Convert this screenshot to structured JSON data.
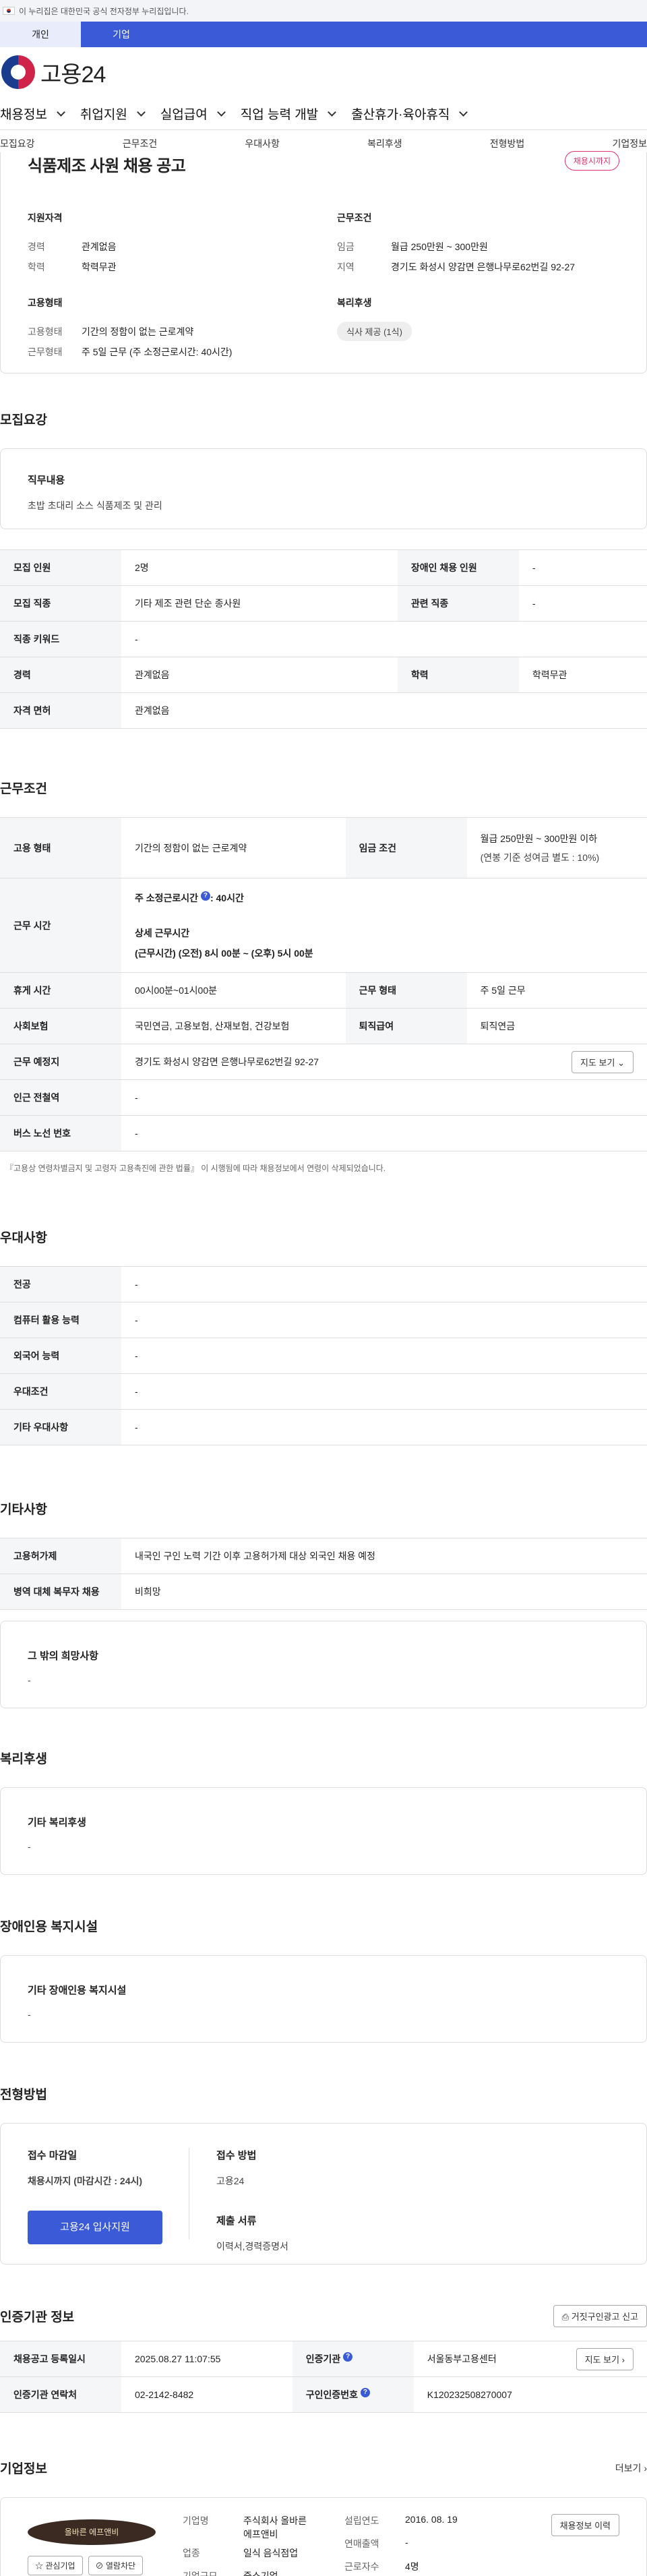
{
  "gov_banner": "이 누리집은 대한민국 공식 전자정부 누리집입니다.",
  "user_tabs": [
    "개인",
    "기업"
  ],
  "logo": "고용24",
  "gnb": [
    "채용정보",
    "취업지원",
    "실업급여",
    "직업 능력 개발",
    "출산휴가·육아휴직"
  ],
  "anchors": [
    "모집요강",
    "근무조건",
    "우대사항",
    "복리후생",
    "전형방법",
    "기업정보"
  ],
  "job": {
    "title": "식품제조 사원 채용 공고",
    "status": "채용시까지",
    "qual_title": "지원자격",
    "qual": [
      {
        "k": "경력",
        "v": "관계없음"
      },
      {
        "k": "학력",
        "v": "학력무관"
      }
    ],
    "emp_title": "고용형태",
    "emp": [
      {
        "k": "고용형태",
        "v": "기간의 정함이 없는 근로계약"
      },
      {
        "k": "근무형태",
        "v": "주 5일 근무 (주 소정근로시간: 40시간)"
      }
    ],
    "cond_title": "근무조건",
    "cond": [
      {
        "k": "임금",
        "v": "월급 250만원 ~ 300만원"
      },
      {
        "k": "지역",
        "v": "경기도 화성시 양감면 은행나무로62번길 92-27"
      }
    ],
    "welfare_title": "복리후생",
    "welfare_chip": "식사 제공 (1식)"
  },
  "recruit": {
    "section": "모집요강",
    "duty_title": "직무내용",
    "duty": "초밥 초대리 소스 식품제조 및 관리",
    "rows": [
      {
        "k1": "모집 인원",
        "v1": "2명",
        "k2": "장애인 채용 인원",
        "v2": "-"
      },
      {
        "k1": "모집 직종",
        "v1": "기타 제조 관련 단순 종사원",
        "k2": "관련 직종",
        "v2": "-"
      },
      {
        "k1": "직종 키워드",
        "v1": "-"
      },
      {
        "k1": "경력",
        "v1": "관계없음",
        "k2": "학력",
        "v2": "학력무관"
      },
      {
        "k1": "자격 면허",
        "v1": "관계없음"
      }
    ]
  },
  "work": {
    "section": "근무조건",
    "type_k": "고용 형태",
    "type_v": "기간의 정함이 없는 근로계약",
    "wage_k": "임금 조건",
    "wage_v1": "월급 250만원 ~ 300만원 이하",
    "wage_v2": "(연봉 기준 성여금 별도 : 10%)",
    "hours_k": "근무 시간",
    "hours_v1a": "주 소정근로시간",
    "hours_v1b": ": 40시간",
    "hours_v2": "상세 근무시간",
    "hours_v3": "(근무시간) (오전) 8시 00분 ~ (오후) 5시 00분",
    "break_k": "휴게 시간",
    "break_v": "00시00분~01시00분",
    "form_k": "근무 형태",
    "form_v": "주 5일 근무",
    "ins_k": "사회보험",
    "ins_v": "국민연금, 고용보험, 산재보험, 건강보험",
    "ret_k": "퇴직급여",
    "ret_v": "퇴직연금",
    "place_k": "근무 예정지",
    "place_v": "경기도 화성시 양감면 은행나무로62번길 92-27",
    "map_btn": "지도 보기",
    "station_k": "인근 전철역",
    "station_v": "-",
    "bus_k": "버스 노선 번호",
    "bus_v": "-",
    "note": "『고용상 연령차별금지 및 고령자 고용촉진에 관한 법률』 이 시행됨에 따라 채용정보에서 연령이 삭제되었습니다."
  },
  "pref": {
    "section": "우대사항",
    "rows": [
      {
        "k": "전공",
        "v": "-"
      },
      {
        "k": "컴퓨터 활용 능력",
        "v": "-"
      },
      {
        "k": "외국어 능력",
        "v": "-"
      },
      {
        "k": "우대조건",
        "v": "-"
      },
      {
        "k": "기타 우대사항",
        "v": "-"
      }
    ]
  },
  "etc": {
    "section": "기타사항",
    "rows": [
      {
        "k": "고용허가제",
        "v": "내국인 구인 노력 기간 이후 고용허가제 대상 외국인 채용 예정"
      },
      {
        "k": "병역 대체 복무자 채용",
        "v": "비희망"
      }
    ],
    "other_title": "그 밖의 희망사항",
    "other_v": "-"
  },
  "benefit": {
    "section": "복리후생",
    "title": "기타 복리후생",
    "v": "-"
  },
  "disabled": {
    "section": "장애인용 복지시설",
    "title": "기타 장애인용 복지시설",
    "v": "-"
  },
  "process": {
    "section": "전형방법",
    "deadline_title": "접수 마감일",
    "deadline_v": "채용시까지 (마감시간 : 24시)",
    "apply_btn": "고용24 입사지원",
    "method_title": "접수 방법",
    "method_v": "고용24",
    "docs_title": "제출 서류",
    "docs_v": "이력서,경력증명서"
  },
  "agency": {
    "section": "인증기관 정보",
    "report_btn": "거짓구인광고 신고",
    "reg_k": "채용공고 등록일시",
    "reg_v": "2025.08.27 11:07:55",
    "org_k": "인증기관",
    "org_v": "서울동부고용센터",
    "map_btn": "지도 보기",
    "tel_k": "인증기관 연락처",
    "tel_v": "02-2142-8482",
    "no_k": "구인인증번호",
    "no_v": "K120232508270007"
  },
  "company": {
    "section": "기업정보",
    "more": "더보기",
    "logo_text": "올바른 에프앤비",
    "fav_btn": "관심기업",
    "block_btn": "열람차단",
    "name_k": "기업명",
    "name_v1": "주식회사 올바른",
    "name_v2": "에프앤비",
    "ind_k": "업종",
    "ind_v": "일식 음식점업",
    "size_k": "기업규모",
    "size_v": "중소기업",
    "year_k": "설립연도",
    "year_v": "2016. 08. 19",
    "sales_k": "연매출액",
    "sales_v": "-",
    "emp_k": "근로자수",
    "emp_v": "4명",
    "hist_btn": "채용정보 이력"
  }
}
